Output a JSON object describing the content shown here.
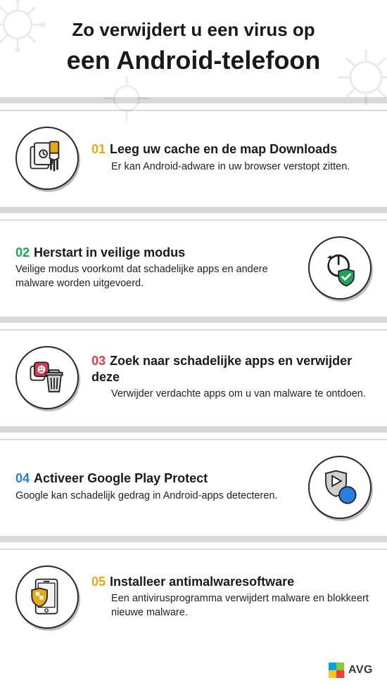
{
  "colors": {
    "accent1": "#e6a817",
    "accent2": "#1fa35a",
    "accent3": "#e03a4f",
    "accent4": "#2a7de1",
    "accent5": "#e6a817"
  },
  "header": {
    "line1": "Zo verwijdert u een virus op",
    "line2": "een Android-telefoon"
  },
  "steps": [
    {
      "num": "01",
      "title": "Leeg uw cache en de map Downloads",
      "desc": "Er kan Android-adware in uw browser verstopt zitten.",
      "icon": "brush-icon",
      "side": "left",
      "accent": "accent1"
    },
    {
      "num": "02",
      "title": "Herstart in veilige modus",
      "desc": "Veilige modus voorkomt dat schadelijke apps en andere malware worden uitgevoerd.",
      "icon": "power-shield-icon",
      "side": "right",
      "accent": "accent2"
    },
    {
      "num": "03",
      "title": "Zoek naar schadelijke apps en verwijder deze",
      "desc": "Verwijder verdachte apps om u van malware te ontdoen.",
      "icon": "trash-app-icon",
      "side": "left",
      "accent": "accent3"
    },
    {
      "num": "04",
      "title": "Activeer Google Play Protect",
      "desc": "Google kan schadelijk gedrag in Android-apps detecteren.",
      "icon": "play-protect-icon",
      "side": "right",
      "accent": "accent4"
    },
    {
      "num": "05",
      "title": "Installeer antimalwaresoftware",
      "desc": "Een antivirusprogramma verwijdert malware en blokkeert nieuwe malware.",
      "icon": "phone-shield-icon",
      "side": "left",
      "accent": "accent5"
    }
  ],
  "brand": {
    "name": "AVG"
  }
}
